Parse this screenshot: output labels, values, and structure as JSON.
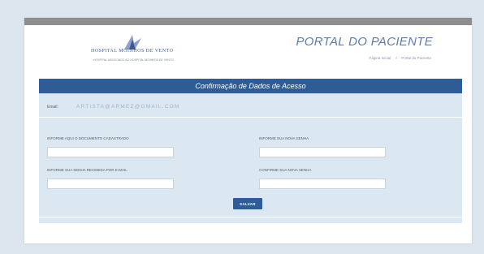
{
  "header": {
    "logo_name": "HOSPITAL MOINHOS DE VENTO",
    "logo_tagline": "HOSPITAL ASSOCIADO AO HOSPITAL MOINHOS DE VENTO",
    "portal_title": "PORTAL DO PACIENTE",
    "breadcrumb": [
      "Página Inicial",
      "»",
      "Portal do Paciente"
    ]
  },
  "form": {
    "title": "Confirmação de Dados de Acesso",
    "email_label": "Email:",
    "email_value": "ARTISTA@ARMEZ@GMAIL.COM",
    "fields": [
      {
        "label": "INFORME AQUI O DOCUMENTO CADASTRADO",
        "value": ""
      },
      {
        "label": "INFORME SUA NOVA SENHA",
        "value": ""
      },
      {
        "label": "INFORME SUA SENHA RECEBIDA POR E-MAIL",
        "value": ""
      },
      {
        "label": "CONFIRME SUA NOVA SENHA",
        "value": ""
      }
    ],
    "save_label": "SALVAR"
  },
  "colors": {
    "page_bg": "#dde6ee",
    "topbar": "#8e8e8e",
    "brand_blue": "#2e5c97",
    "panel_bg": "#dce8f1",
    "title_text": "#5f7daa"
  }
}
